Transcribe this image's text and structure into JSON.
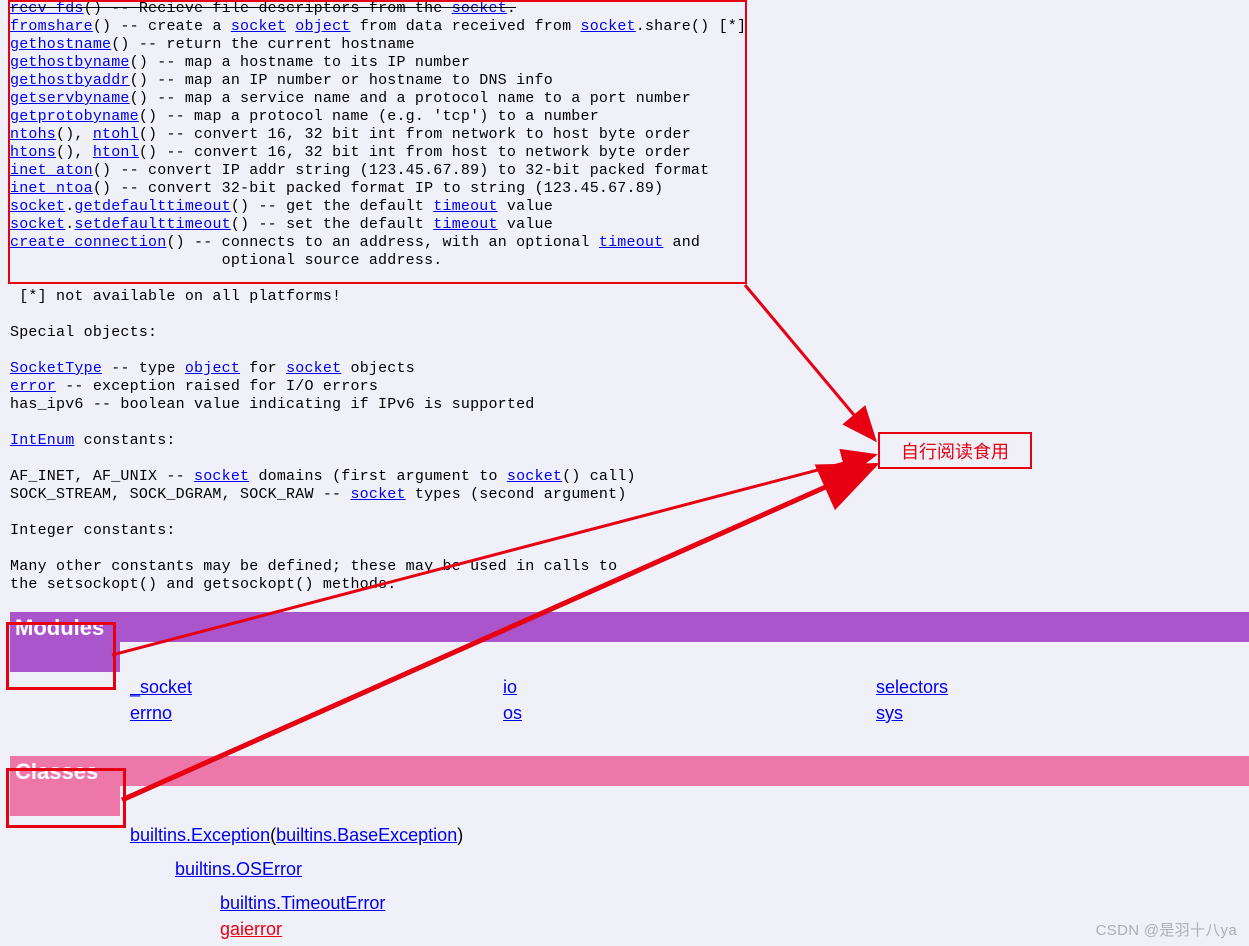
{
  "doc": {
    "l1": {
      "fn": "recv_fds",
      "rest": "() -- Recieve file descriptors from the ",
      "link": "socket",
      "after": "."
    },
    "l2": {
      "fn": "fromshare",
      "p1": "() -- create a ",
      "link1": "socket",
      "sp1": " ",
      "link2": "object",
      "p2": " from data received from ",
      "link3": "socket",
      "p3": ".share() [*]"
    },
    "l3": {
      "fn": "gethostname",
      "rest": "() -- return the current hostname"
    },
    "l4": {
      "fn": "gethostbyname",
      "rest": "() -- map a hostname to its IP number"
    },
    "l5": {
      "fn": "gethostbyaddr",
      "rest": "() -- map an IP number or hostname to DNS info"
    },
    "l6": {
      "fn": "getservbyname",
      "rest": "() -- map a service name and a protocol name to a port number"
    },
    "l7": {
      "fn": "getprotobyname",
      "rest": "() -- map a protocol name (e.g. 'tcp') to a number"
    },
    "l8": {
      "a": "ntohs",
      "mid": "(), ",
      "b": "ntohl",
      "rest": "() -- convert 16, 32 bit int from network to host byte order"
    },
    "l9": {
      "a": "htons",
      "mid": "(), ",
      "b": "htonl",
      "rest": "() -- convert 16, 32 bit int from host to network byte order"
    },
    "l10": {
      "fn": "inet_aton",
      "rest": "() -- convert IP addr string (123.45.67.89) to 32-bit packed format"
    },
    "l11": {
      "fn": "inet_ntoa",
      "rest": "() -- convert 32-bit packed format IP to string (123.45.67.89)"
    },
    "l12": {
      "a": "socket",
      "dot": ".",
      "b": "getdefaulttimeout",
      "mid": "() -- get the default ",
      "c": "timeout",
      "rest": " value"
    },
    "l13": {
      "a": "socket",
      "dot": ".",
      "b": "setdefaulttimeout",
      "mid": "() -- set the default ",
      "c": "timeout",
      "rest": " value"
    },
    "l14": {
      "fn": "create_connection",
      "mid": "() -- connects to an address, with an optional ",
      "c": "timeout",
      "rest": " and"
    },
    "l15": "                       optional source address.",
    "blank1": "",
    "l16": " [*] not available on all platforms!",
    "blank2": "",
    "l17": "Special objects:",
    "blank3": "",
    "l18": {
      "a": "SocketType",
      "p1": " -- type ",
      "b": "object",
      "p2": " for ",
      "c": "socket",
      "p3": " objects"
    },
    "l19": {
      "a": "error",
      "rest": " -- exception raised for I/O errors"
    },
    "l20": "has_ipv6 -- boolean value indicating if IPv6 is supported",
    "blank4": "",
    "l21": {
      "a": "IntEnum",
      "rest": " constants:"
    },
    "blank5": "",
    "l22": {
      "pre": "AF_INET, AF_UNIX -- ",
      "a": "socket",
      "mid": " domains (first argument to ",
      "b": "socket",
      "rest": "() call)"
    },
    "l23": {
      "pre": "SOCK_STREAM, SOCK_DGRAM, SOCK_RAW -- ",
      "a": "socket",
      "rest": " types (second argument)"
    },
    "blank6": "",
    "l24": "Integer constants:",
    "blank7": "",
    "l25": "Many other constants may be defined; these may be used in calls to",
    "l26": "the setsockopt() and getsockopt() methods."
  },
  "sections": {
    "modules": {
      "title": "Modules",
      "col1": [
        "_socket",
        "errno"
      ],
      "col2": [
        "io",
        "os"
      ],
      "col3": [
        "selectors",
        "sys"
      ]
    },
    "classes": {
      "title": "Classes",
      "row1_a": "builtins.Exception",
      "row1_paren_open": "(",
      "row1_b": "builtins.BaseException",
      "row1_paren_close": ")",
      "row2": "builtins.OSError",
      "row3": "builtins.TimeoutError",
      "row4": "gaierror"
    }
  },
  "annotation": "自行阅读食用",
  "watermark": "CSDN @是羽十八ya"
}
